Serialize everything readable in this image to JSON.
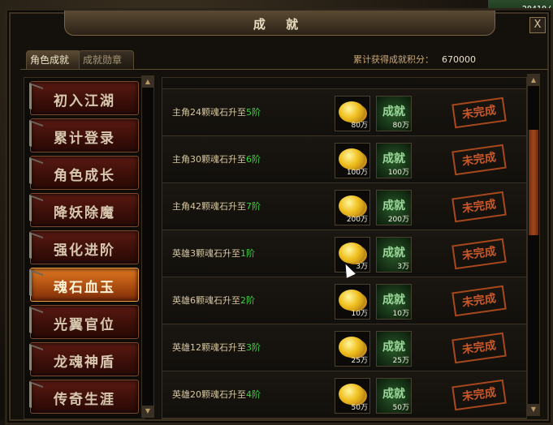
{
  "hud": {
    "coords": "20410/"
  },
  "window": {
    "title": "成 就",
    "close_label": "X"
  },
  "tabs": [
    {
      "label": "角色成就",
      "active": true
    },
    {
      "label": "成就勋章",
      "active": false
    }
  ],
  "score": {
    "label": "累计获得成就积分：",
    "value": "670000"
  },
  "categories": [
    {
      "label": "初入江湖"
    },
    {
      "label": "累计登录"
    },
    {
      "label": "角色成长"
    },
    {
      "label": "降妖除魔"
    },
    {
      "label": "强化进阶"
    },
    {
      "label": "魂石血玉",
      "selected": true
    },
    {
      "label": "光翼官位"
    },
    {
      "label": "龙魂神盾"
    },
    {
      "label": "传奇生涯"
    }
  ],
  "achievements": [
    {
      "prefix": "主角24颗魂石升至",
      "level": "5阶",
      "gold": "80万",
      "ach_label": "成就",
      "ach": "80万",
      "status": "未完成"
    },
    {
      "prefix": "主角30颗魂石升至",
      "level": "6阶",
      "gold": "100万",
      "ach_label": "成就",
      "ach": "100万",
      "status": "未完成"
    },
    {
      "prefix": "主角42颗魂石升至",
      "level": "7阶",
      "gold": "200万",
      "ach_label": "成就",
      "ach": "200万",
      "status": "未完成"
    },
    {
      "prefix": "英雄3颗魂石升至",
      "level": "1阶",
      "gold": "3万",
      "ach_label": "成就",
      "ach": "3万",
      "status": "未完成"
    },
    {
      "prefix": "英雄6颗魂石升至",
      "level": "2阶",
      "gold": "10万",
      "ach_label": "成就",
      "ach": "10万",
      "status": "未完成"
    },
    {
      "prefix": "英雄12颗魂石升至",
      "level": "3阶",
      "gold": "25万",
      "ach_label": "成就",
      "ach": "25万",
      "status": "未完成"
    },
    {
      "prefix": "英雄20颗魂石升至",
      "level": "4阶",
      "gold": "50万",
      "ach_label": "成就",
      "ach": "50万",
      "status": "未完成"
    }
  ],
  "scroll_arrows": {
    "up": "▲",
    "down": "▼"
  }
}
